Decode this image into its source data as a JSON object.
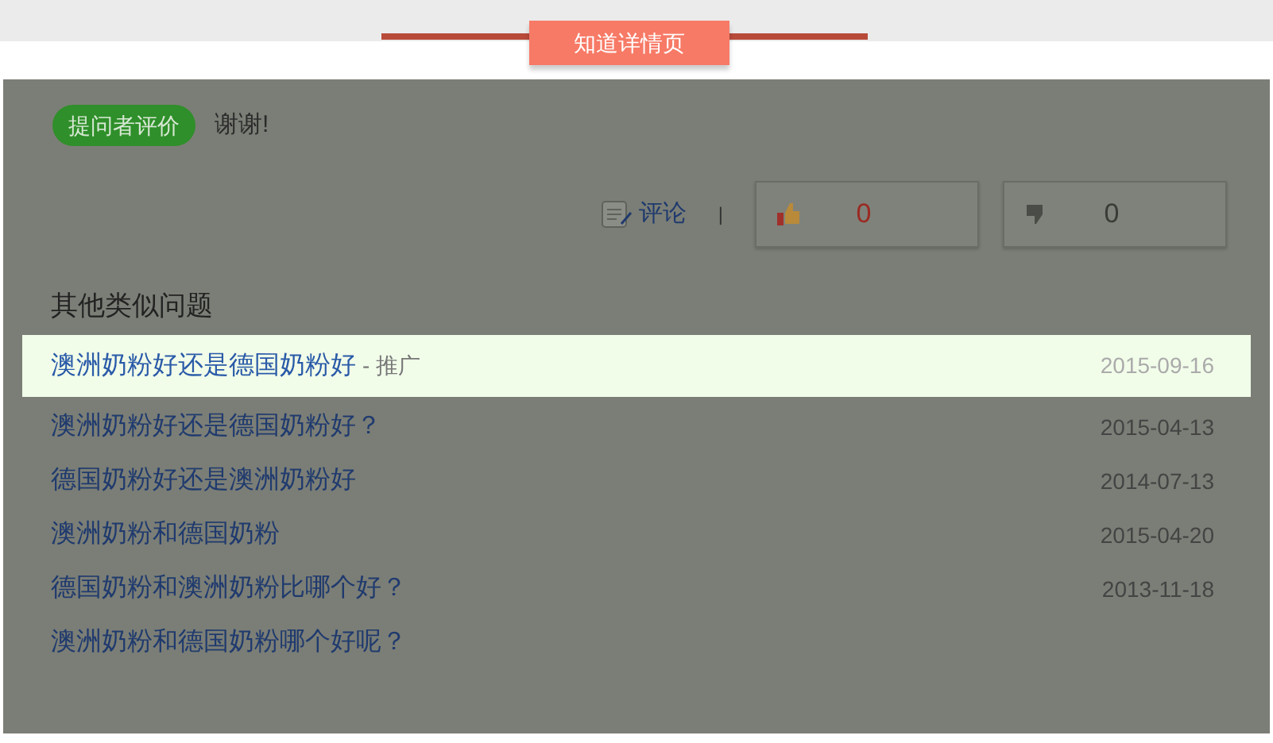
{
  "banner": {
    "title": "知道详情页"
  },
  "rating": {
    "badge": "提问者评价",
    "text": "谢谢!"
  },
  "actions": {
    "comment": "评论",
    "separator": "|",
    "likes": "0",
    "dislikes": "0"
  },
  "similar": {
    "heading": "其他类似问题",
    "rows": [
      {
        "title": "澳洲奶粉好还是德国奶粉好",
        "tag": "- 推广",
        "date": "2015-09-16",
        "selected": true
      },
      {
        "title": "澳洲奶粉好还是德国奶粉好？",
        "date": "2015-04-13",
        "selected": false
      },
      {
        "title": "德国奶粉好还是澳洲奶粉好",
        "date": "2014-07-13",
        "selected": false
      },
      {
        "title": "澳洲奶粉和德国奶粉",
        "date": "2015-04-20",
        "selected": false
      },
      {
        "title": "德国奶粉和澳洲奶粉比哪个好？",
        "date": "2013-11-18",
        "selected": false
      },
      {
        "title": "澳洲奶粉和德国奶粉哪个好呢？",
        "selected": false
      }
    ]
  }
}
